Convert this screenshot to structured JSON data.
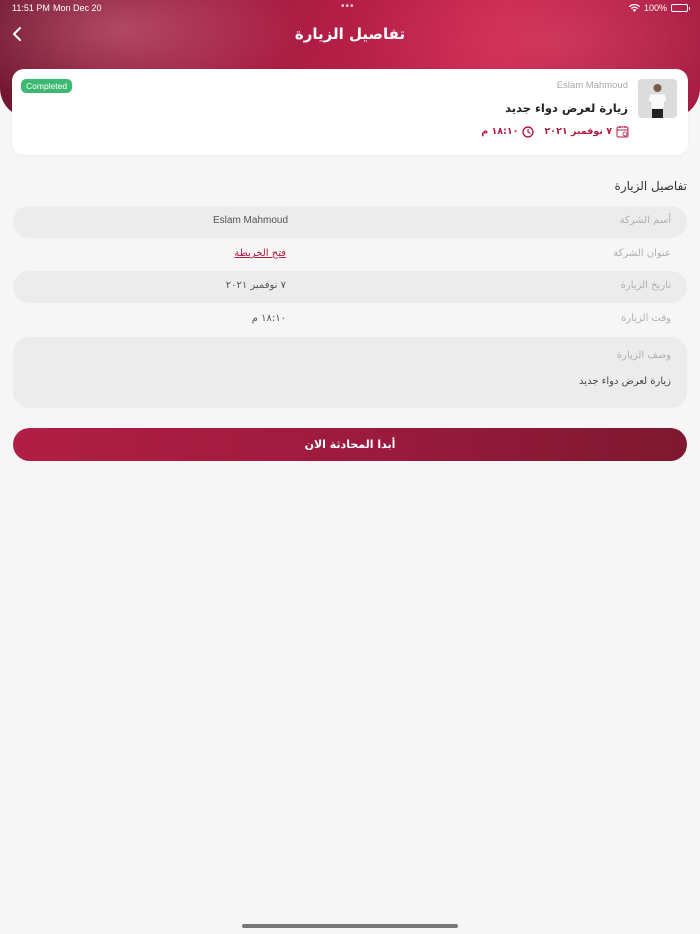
{
  "status_bar": {
    "time": "11:51 PM",
    "date": "Mon Dec 20",
    "dots": "•••",
    "battery": "100%"
  },
  "header": {
    "title": "تفاصيل الزيارة",
    "back_icon": "chevron-left-icon"
  },
  "visit_card": {
    "rep_name": "Eslam Mahmoud",
    "visit_title": "زيارة لعرض دواء جديد",
    "status": "Completed",
    "date": "٧ نوفمبر ٢٠٢١",
    "time": "١٨:١٠ م",
    "date_icon": "calendar-icon",
    "time_icon": "clock-icon"
  },
  "details": {
    "section_title": "تفاصيل الزيارة",
    "company_name_label": "أسم الشركة",
    "company_name_value": "Eslam Mahmoud",
    "company_address_label": "عنوان الشركة",
    "company_address_value": "فتح الخريطة",
    "visit_date_label": "تاريخ الزيارة",
    "visit_date_value": "٧ نوفمبر ٢٠٢١",
    "visit_time_label": "وقت الزيارة",
    "visit_time_value": "١٨:١٠ م",
    "description_label": "وصف الزيارة",
    "description_value": "زيارة لعرض دواء جديد"
  },
  "actions": {
    "start_chat": "أبدا المحادثة الان"
  },
  "colors": {
    "brand": "#b11e45",
    "status_completed": "#3db870"
  }
}
